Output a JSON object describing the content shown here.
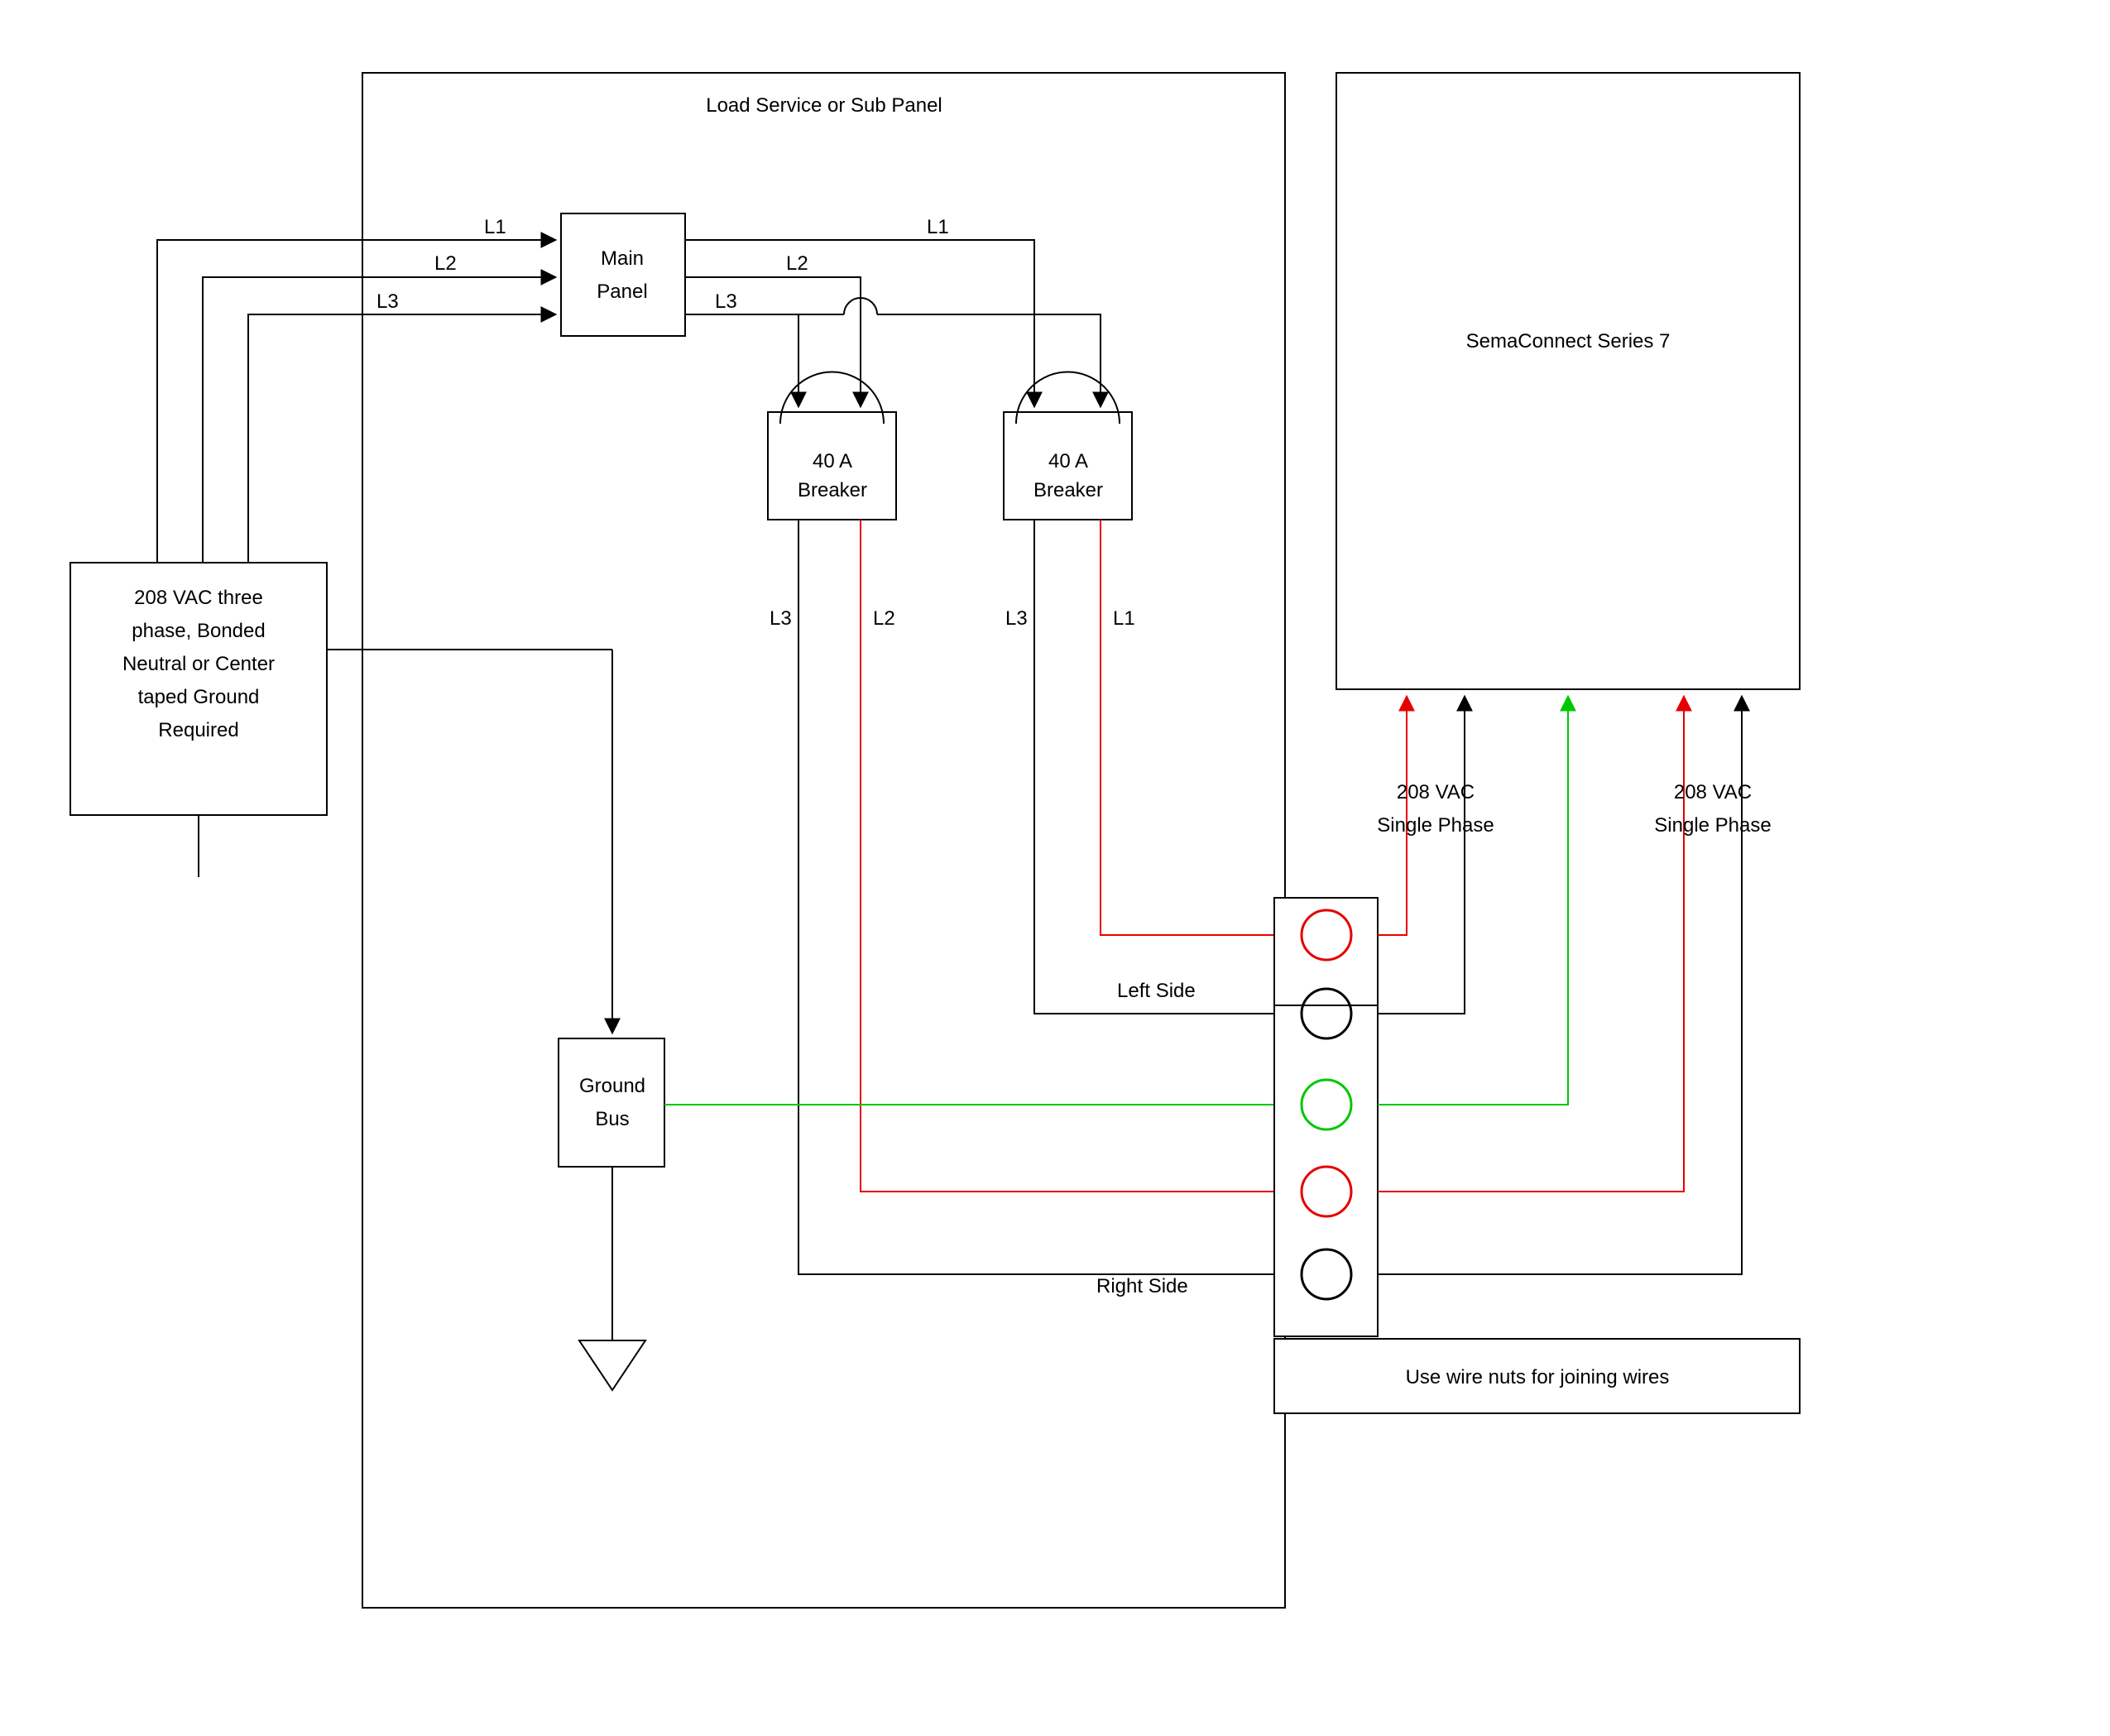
{
  "boxes": {
    "panel_title": "Load Service or Sub Panel",
    "source": "208 VAC three phase, Bonded Neutral or Center taped Ground Required",
    "main_panel": "Main Panel",
    "breaker1": "40 A Breaker",
    "breaker2": "40 A Breaker",
    "ground_bus": "Ground Bus",
    "sema": "SemaConnect Series 7",
    "left_side": "Left Side",
    "right_side": "Right Side",
    "wire_nuts": "Use wire nuts for joining wires"
  },
  "wires": {
    "L1": "L1",
    "L2": "L2",
    "L3": "L3"
  },
  "phase": {
    "p1": "208 VAC Single Phase",
    "p2": "208 VAC Single Phase"
  },
  "colors": {
    "red": "#e60000",
    "green": "#00c800",
    "black": "#000000"
  }
}
